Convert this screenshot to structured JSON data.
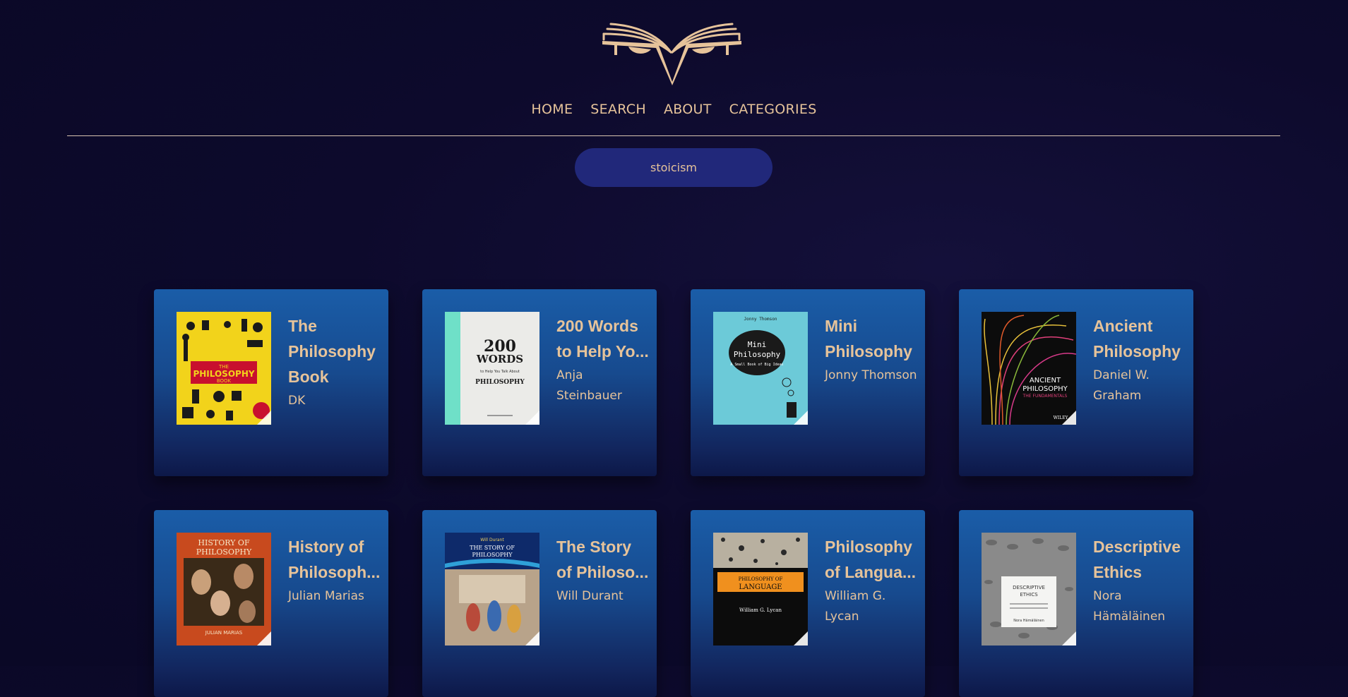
{
  "nav": {
    "items": [
      {
        "label": "HOME"
      },
      {
        "label": "SEARCH"
      },
      {
        "label": "ABOUT"
      },
      {
        "label": "CATEGORIES"
      }
    ]
  },
  "search": {
    "query": "stoicism"
  },
  "books": [
    {
      "title": "The Philosophy Book",
      "author": "DK",
      "cover_text": "THE PHILOSOPHY BOOK"
    },
    {
      "title": "200 Words to Help Yo...",
      "author": "Anja Steinbauer",
      "cover_text": "200 WORDS",
      "cover_subtitle": "to Help You Talk About",
      "cover_bottom": "PHILOSOPHY"
    },
    {
      "title": "Mini Philosophy",
      "author": "Jonny Thomson",
      "cover_text": "Mini Philosophy",
      "cover_subtitle": "A Small Book of Big Ideas",
      "cover_top": "Jonny Thomson"
    },
    {
      "title": "Ancient Philosophy",
      "author": "Daniel W. Graham",
      "cover_text": "ANCIENT PHILOSOPHY",
      "cover_subtitle": "THE FUNDAMENTALS",
      "cover_bottom": "WILEY"
    },
    {
      "title": "History of Philosoph...",
      "author": "Julian Marias",
      "cover_text": "HISTORY OF PHILOSOPHY"
    },
    {
      "title": "The Story of Philoso...",
      "author": "Will Durant",
      "cover_text": "THE STORY OF PHILOSOPHY",
      "cover_top": "Will Durant"
    },
    {
      "title": "Philosophy of Langua...",
      "author": "William G. Lycan",
      "cover_text": "PHILOSOPHY OF LANGUAGE",
      "cover_bottom": "William G. Lycan"
    },
    {
      "title": "Descriptive Ethics",
      "author": "Nora Hämäläinen",
      "cover_text": "DESCRIPTIVE ETHICS",
      "cover_subtitle": "What does Moral Philosophy Know about Morality?",
      "cover_bottom": "Nora Hämäläinen"
    }
  ],
  "colors": {
    "accent": "#e6c39a",
    "background": "#0d0a2c",
    "card_top": "#1a5da8",
    "card_bottom": "#0d1848",
    "search_pill": "#21287a"
  }
}
